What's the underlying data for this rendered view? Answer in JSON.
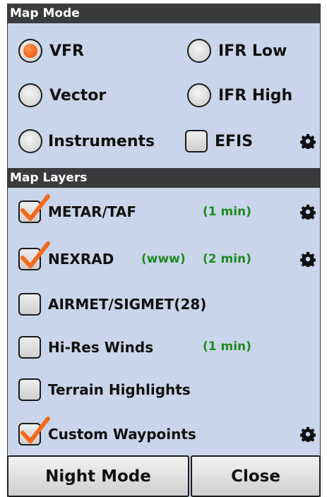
{
  "map_mode": {
    "header": "Map Mode",
    "options": [
      {
        "label": "VFR",
        "selected": true
      },
      {
        "label": "IFR Low",
        "selected": false
      },
      {
        "label": "Vector",
        "selected": false
      },
      {
        "label": "IFR High",
        "selected": false
      },
      {
        "label": "Instruments",
        "selected": false
      }
    ],
    "efis": {
      "label": "EFIS",
      "checked": false
    }
  },
  "map_layers": {
    "header": "Map Layers",
    "items": [
      {
        "label": "METAR/TAF",
        "checked": true,
        "status": "(1 min)",
        "source": "",
        "gear": true
      },
      {
        "label": "NEXRAD",
        "checked": true,
        "status": "(2 min)",
        "source": "(www)",
        "gear": true
      },
      {
        "label": "AIRMET/SIGMET(28)",
        "checked": false,
        "status": "",
        "source": "",
        "gear": false
      },
      {
        "label": "Hi-Res Winds",
        "checked": false,
        "status": "(1 min)",
        "source": "",
        "gear": false
      },
      {
        "label": "Terrain Highlights",
        "checked": false,
        "status": "",
        "source": "",
        "gear": false
      },
      {
        "label": "Custom Waypoints",
        "checked": true,
        "status": "",
        "source": "",
        "gear": true
      }
    ]
  },
  "buttons": {
    "night_mode": "Night Mode",
    "close": "Close"
  },
  "colors": {
    "selected_radio": "#f35c12",
    "check_mark": "#f26a1b",
    "status_text": "#1e8a1e",
    "header_bg": "#3a3b3d",
    "panel_bg": "#c9d5ea"
  },
  "icons": {
    "settings": "gear-icon"
  }
}
